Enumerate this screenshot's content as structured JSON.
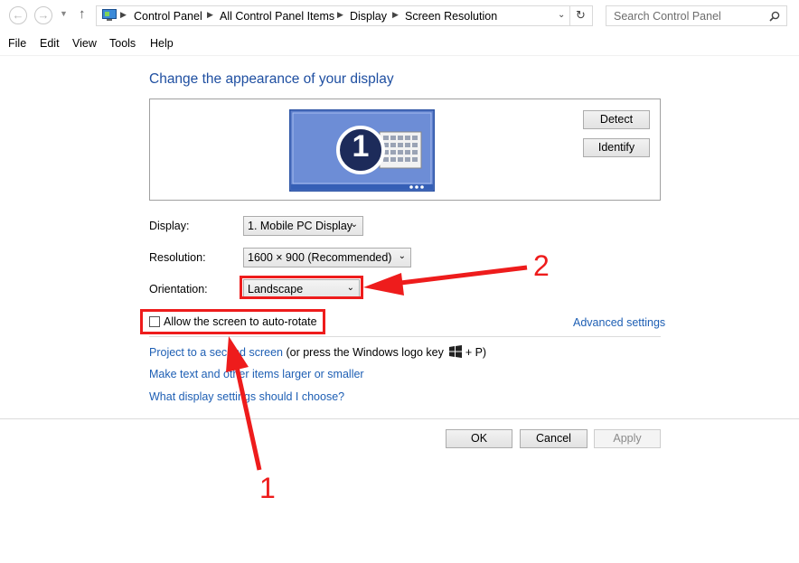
{
  "breadcrumb": [
    "Control Panel",
    "All Control Panel Items",
    "Display",
    "Screen Resolution"
  ],
  "search": {
    "placeholder": "Search Control Panel"
  },
  "menu": [
    "File",
    "Edit",
    "View",
    "Tools",
    "Help"
  ],
  "page_title": "Change the appearance of your display",
  "preview": {
    "monitor_number": "1",
    "detect_label": "Detect",
    "identify_label": "Identify"
  },
  "form": {
    "display_label": "Display:",
    "display_value": "1. Mobile PC Display",
    "resolution_label": "Resolution:",
    "resolution_value": "1600 × 900 (Recommended)",
    "orientation_label": "Orientation:",
    "orientation_value": "Landscape",
    "autorotate_label": "Allow the screen to auto-rotate",
    "advanced_link": "Advanced settings"
  },
  "links": {
    "project_link": "Project to a second screen",
    "project_hint_pre": " (or press the Windows logo key",
    "project_hint_post": " + P)",
    "text_size_link": "Make text and other items larger or smaller",
    "help_link": "What display settings should I choose?"
  },
  "buttons": {
    "ok": "OK",
    "cancel": "Cancel",
    "apply": "Apply"
  },
  "annotations": {
    "callout_1": "1",
    "callout_2": "2",
    "highlight_color": "#ee1c1c"
  }
}
